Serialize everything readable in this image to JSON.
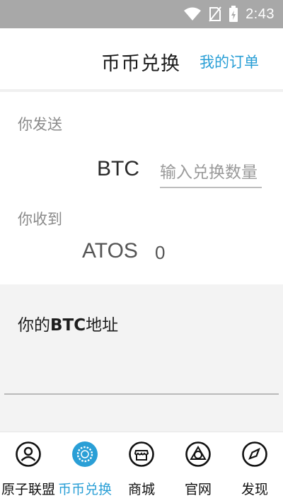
{
  "statusbar": {
    "time": "2:43"
  },
  "header": {
    "title": "币币兑换",
    "orders_link": "我的订单"
  },
  "exchange": {
    "send_label": "你发送",
    "send_currency": "BTC",
    "amount_placeholder": "输入兑换数量",
    "receive_label": "你收到",
    "receive_currency": "ATOS",
    "receive_amount": "0"
  },
  "address": {
    "label_prefix": "你的",
    "label_currency": "BTC",
    "label_suffix": "地址"
  },
  "tabs": [
    {
      "label": "原子联盟",
      "icon": "user-icon"
    },
    {
      "label": "币币兑换",
      "icon": "exchange-icon",
      "active": true
    },
    {
      "label": "商城",
      "icon": "shop-icon"
    },
    {
      "label": "官网",
      "icon": "website-icon"
    },
    {
      "label": "发现",
      "icon": "compass-icon"
    }
  ],
  "colors": {
    "accent": "#2a9fd6",
    "statusbar": "#a8a8a8",
    "section_bg": "#f3f3f3"
  }
}
